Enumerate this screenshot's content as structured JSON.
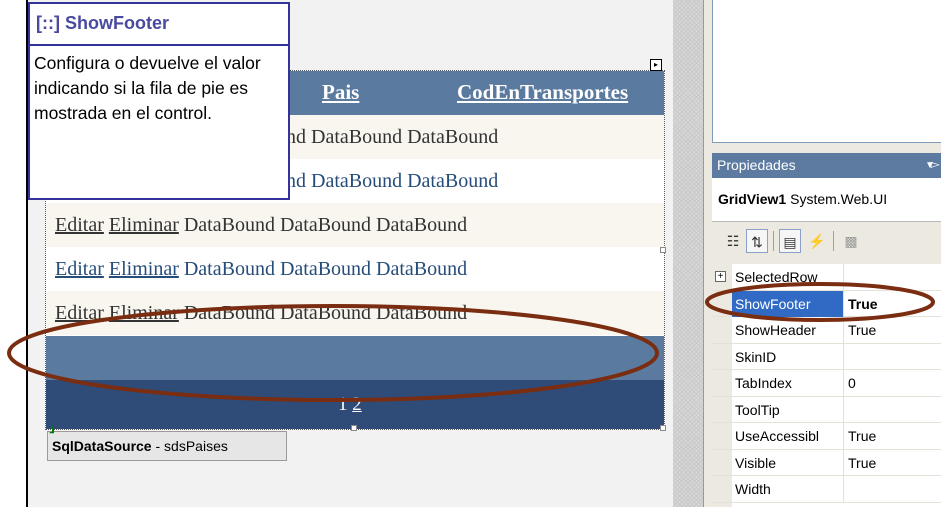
{
  "tooltip": {
    "title": "[::] ShowFooter",
    "body": "Configura o devuelve el valor indicando si la fila de pie es mostrada en el control."
  },
  "gridview": {
    "headers": [
      "Pais",
      "CodEnTransportes"
    ],
    "rows": [
      {
        "cells": "nd DataBound DataBound"
      },
      {
        "cells": "nd DataBound DataBound"
      },
      {
        "edit": "Editar",
        "delete": "Eliminar",
        "cells": " DataBound DataBound DataBound"
      },
      {
        "edit": "Editar",
        "delete": "Eliminar",
        "cells": " DataBound DataBound DataBound"
      },
      {
        "edit": "Editar",
        "delete": "Eliminar",
        "cells": " DataBound DataBound DataBound"
      }
    ],
    "pager": {
      "current": "1",
      "next": "2"
    }
  },
  "datasource": {
    "type": "SqlDataSource",
    "sep": " - ",
    "name": "sdsPaises"
  },
  "properties_panel": {
    "title": "Propiedades",
    "object_name": "GridView1",
    "object_type": "System.Web.UI",
    "rows": [
      {
        "name": "SelectedRow",
        "value": "",
        "expandable": true
      },
      {
        "name": "ShowFooter",
        "value": "True",
        "selected": true
      },
      {
        "name": "ShowHeader",
        "value": "True"
      },
      {
        "name": "SkinID",
        "value": ""
      },
      {
        "name": "TabIndex",
        "value": "0"
      },
      {
        "name": "ToolTip",
        "value": ""
      },
      {
        "name": "UseAccessibl",
        "value": "True"
      },
      {
        "name": "Visible",
        "value": "True"
      },
      {
        "name": "Width",
        "value": ""
      }
    ]
  },
  "colors": {
    "header": "#5b7a9f",
    "pager": "#2f4b78",
    "tooltip_border": "#333399",
    "annotation": "#7a2d10",
    "selection": "#316ac5"
  }
}
